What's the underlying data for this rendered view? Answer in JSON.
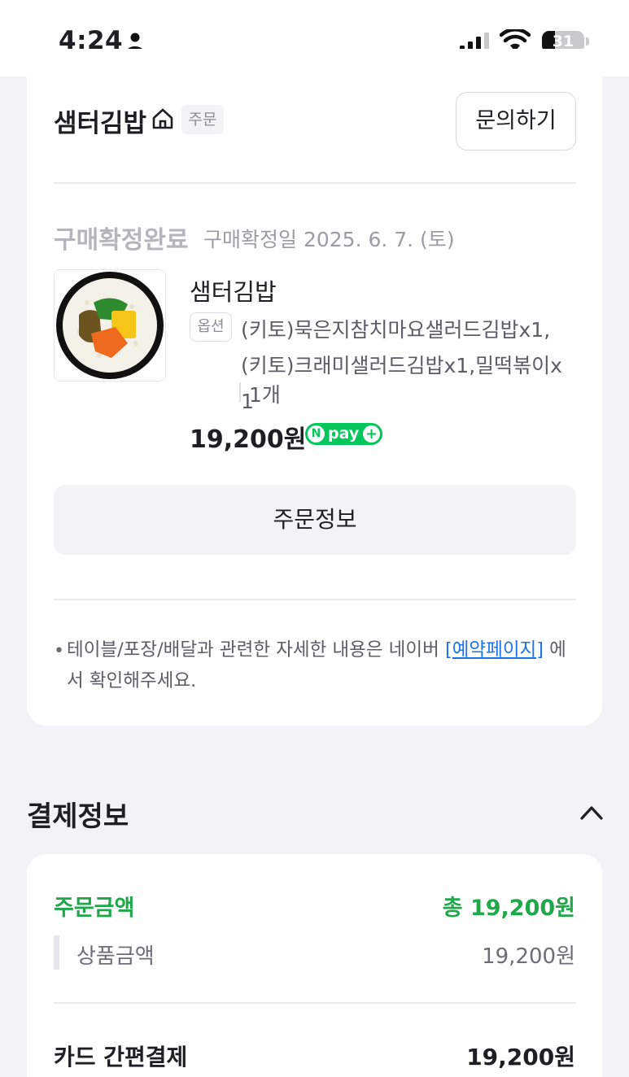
{
  "status_bar": {
    "time": "4:24",
    "battery": "31",
    "battery_level": 0.31
  },
  "store": {
    "name": "샘터김밥",
    "badge": "주문",
    "inquiry_label": "문의하기"
  },
  "order": {
    "status": "구매확정완료",
    "date_text": "구매확정일 2025. 6. 7. (토)",
    "product_name": "샘터김밥",
    "option_tag": "옵션",
    "option_text": "(키토)묵은지참치마요샐러드김밥x1,(키토)크래미샐러드김밥x1,밀떡볶이x1",
    "quantity": "1개",
    "price": "19,200원",
    "npay_n": "N",
    "npay_label": "pay",
    "npay_plus": "+",
    "order_info_label": "주문정보"
  },
  "notice": {
    "bullet": "•",
    "text_before": "테이블/포장/배달과 관련한 자세한 내용은 네이버 ",
    "link": "[예약페이지]",
    "text_after": " 에서 확인해주세요."
  },
  "payment": {
    "section_title": "결제정보",
    "order_amount_label": "주문금액",
    "order_amount_value": "총 19,200원",
    "product_amount_label": "상품금액",
    "product_amount_value": "19,200원",
    "method_label": "카드 간편결제",
    "method_value": "19,200원"
  },
  "colors": {
    "accent_green": "#1ea84a",
    "npay_green": "#03c75a",
    "link_blue": "#1a73e8"
  }
}
